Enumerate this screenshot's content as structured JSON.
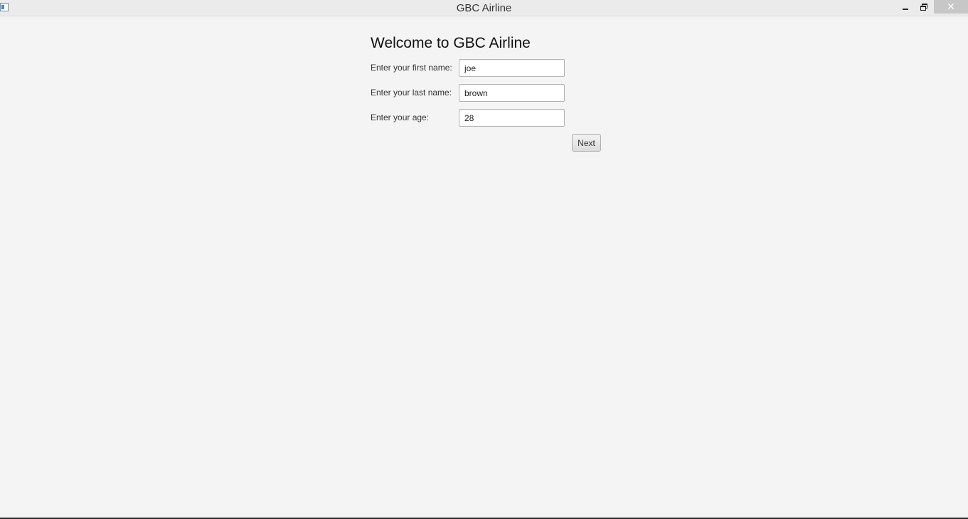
{
  "window": {
    "title": "GBC Airline",
    "controls": {
      "minimize_icon": "minimize-icon",
      "maximize_icon": "restore-icon",
      "close_icon": "close-icon",
      "close_glyph": "✕"
    }
  },
  "form": {
    "heading": "Welcome to GBC Airline",
    "fields": [
      {
        "label": "Enter your first name:",
        "value": "joe"
      },
      {
        "label": "Enter your last name:",
        "value": "brown"
      },
      {
        "label": "Enter your age:",
        "value": "28"
      }
    ],
    "next_label": "Next"
  },
  "colors": {
    "background": "#f4f4f4",
    "titlebar": "#ebebeb",
    "close_button": "#c7c7c7"
  }
}
